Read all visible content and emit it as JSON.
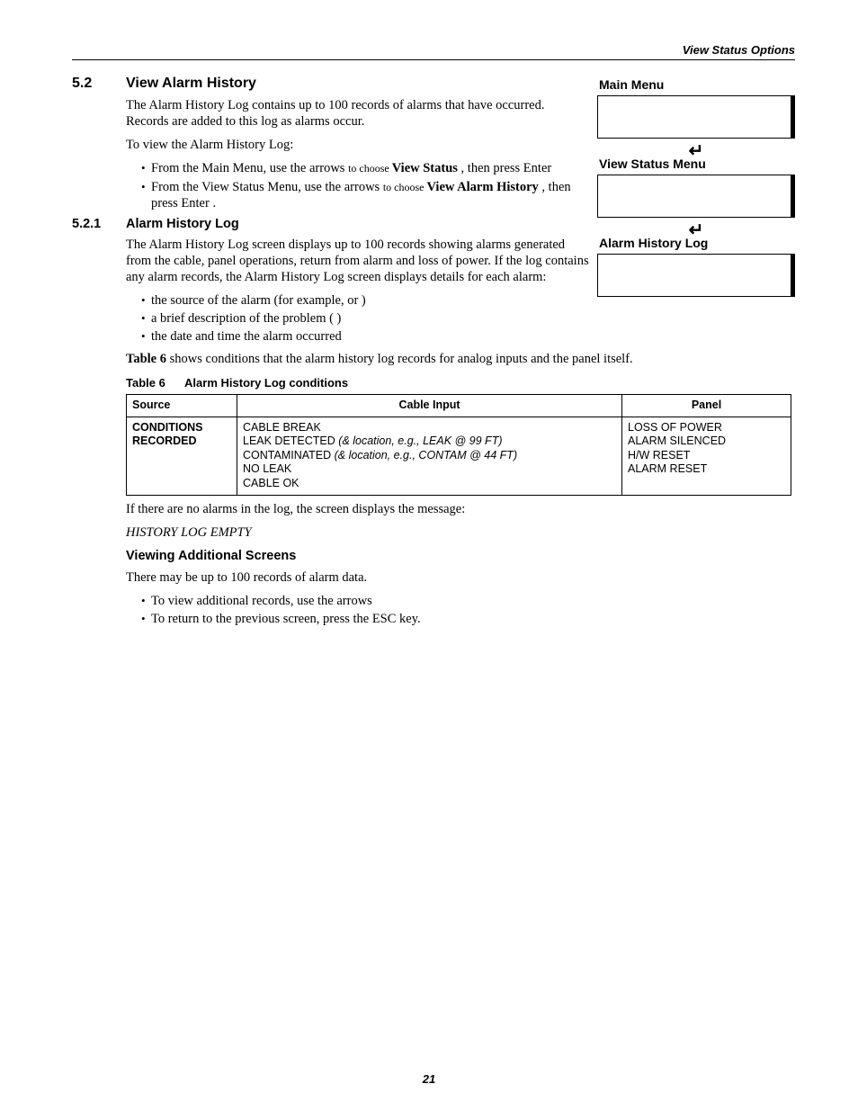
{
  "header": {
    "section_title": "View Status Options"
  },
  "section": {
    "num": "5.2",
    "title": "View Alarm History"
  },
  "intro": {
    "p1": "The Alarm History Log contains up to 100 records of alarms that have occurred. Records are added to this log as alarms occur.",
    "p2": "To view the Alarm History Log:",
    "bullet1_a": "From the Main Menu, use the arrows ",
    "bullet1_b": " to choose ",
    "bullet1_bold": "View Status",
    "bullet1_c": ", then press Enter",
    "bullet2_a": "From the View Status Menu, use the arrows ",
    "bullet2_b": " to choose ",
    "bullet2_bold": "View Alarm History",
    "bullet2_c": ", then press Enter   ."
  },
  "sidebar": {
    "main_menu": "Main Menu",
    "view_status_menu": "View Status Menu",
    "alarm_history_log": "Alarm History Log",
    "enter_glyph": "↵"
  },
  "subsection": {
    "num": "5.2.1",
    "title": "Alarm History Log"
  },
  "sub_body": {
    "p1": "The Alarm History Log screen displays up to 100 records showing alarms generated from the cable, panel operations, return from alarm and loss of power. If the log contains any alarm records, the Alarm History Log screen displays details for each alarm:",
    "b1_a": "the source of the alarm (for example,                    or               )",
    "b2": "a brief description of the problem (                  )",
    "b3": "the date and time the alarm occurred",
    "p2_a": "Table 6",
    "p2_b": " shows conditions that the alarm history log records for analog inputs and the panel itself."
  },
  "table": {
    "caption_num": "Table 6",
    "caption_title": "Alarm History Log conditions",
    "headers": {
      "c0": "Source",
      "c1": "Cable Input",
      "c2": "Panel"
    },
    "row0": {
      "c0": "CONDITIONS RECORDED",
      "c1_l1": "CABLE BREAK",
      "c1_l2a": "LEAK DETECTED ",
      "c1_l2b": "(& location, e.g., LEAK @ 99 FT)",
      "c1_l3a": "CONTAMINATED ",
      "c1_l3b": "(& location, e.g., CONTAM @ 44 FT)",
      "c1_l4": "NO LEAK",
      "c1_l5": "CABLE OK",
      "c2_l1": "LOSS OF POWER",
      "c2_l2": "ALARM SILENCED",
      "c2_l3": "H/W RESET",
      "c2_l4": "ALARM RESET"
    }
  },
  "after": {
    "p1": "If there are no alarms in the log, the screen displays the message:",
    "msg": "HISTORY LOG EMPTY",
    "h4": "Viewing Additional Screens",
    "p2": "There may be up to 100 records of alarm data.",
    "b1": "To view additional records, use the arrows",
    "b2": "To return to the previous screen, press the ESC key."
  },
  "page_number": "21",
  "chart_data": {
    "type": "table",
    "title": "Alarm History Log conditions",
    "columns": [
      "Source",
      "Cable Input",
      "Panel"
    ],
    "rows": [
      {
        "Source": "CONDITIONS RECORDED",
        "Cable Input": [
          "CABLE BREAK",
          "LEAK DETECTED (& location, e.g., LEAK @ 99 FT)",
          "CONTAMINATED (& location, e.g., CONTAM @ 44 FT)",
          "NO LEAK",
          "CABLE OK"
        ],
        "Panel": [
          "LOSS OF POWER",
          "ALARM SILENCED",
          "H/W RESET",
          "ALARM RESET"
        ]
      }
    ]
  }
}
